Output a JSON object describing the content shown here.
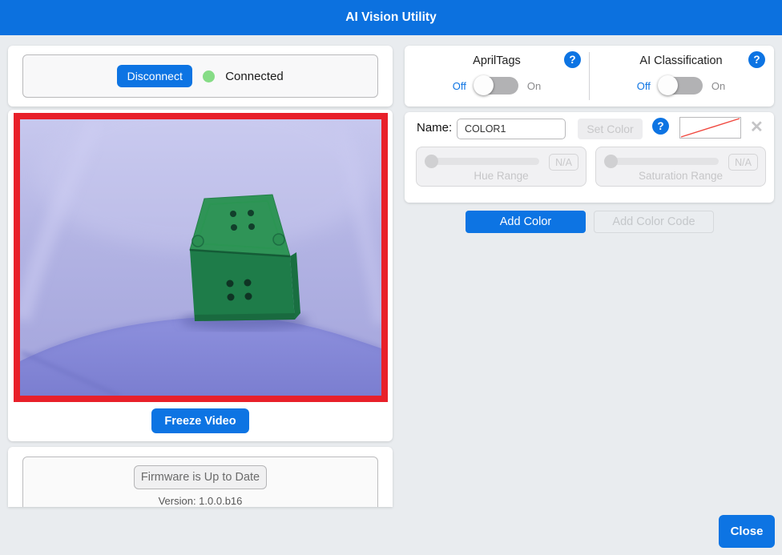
{
  "title_bar": {
    "title": "AI Vision Utility"
  },
  "connection": {
    "disconnect_label": "Disconnect",
    "status_label": "Connected",
    "status_color": "#86dc86"
  },
  "video": {
    "freeze_label": "Freeze Video",
    "frame_color": "#e8202a",
    "scene_description": "green cube with dots inside blue-lit lightbox"
  },
  "features": {
    "apriltags": {
      "label": "AprilTags",
      "off_label": "Off",
      "on_label": "On",
      "state": "off"
    },
    "classification": {
      "label": "AI Classification",
      "off_label": "Off",
      "on_label": "On",
      "state": "off"
    }
  },
  "color_config": {
    "name_label": "Name:",
    "name_value": "COLOR1",
    "set_color_label": "Set Color",
    "hue": {
      "label": "Hue Range",
      "value": "N/A"
    },
    "saturation": {
      "label": "Saturation Range",
      "value": "N/A"
    },
    "add_color_label": "Add Color",
    "add_color_code_label": "Add Color Code"
  },
  "firmware": {
    "button_label": "Firmware is Up to Date",
    "version_label": "Version: 1.0.0.b16"
  },
  "footer": {
    "close_label": "Close"
  },
  "icons": {
    "help_glyph": "?",
    "clear_glyph": "✕"
  },
  "colors": {
    "accent": "#0d74e3",
    "title_bar": "#0c71df",
    "frame_red": "#e8202a",
    "status_green": "#86dc86"
  }
}
